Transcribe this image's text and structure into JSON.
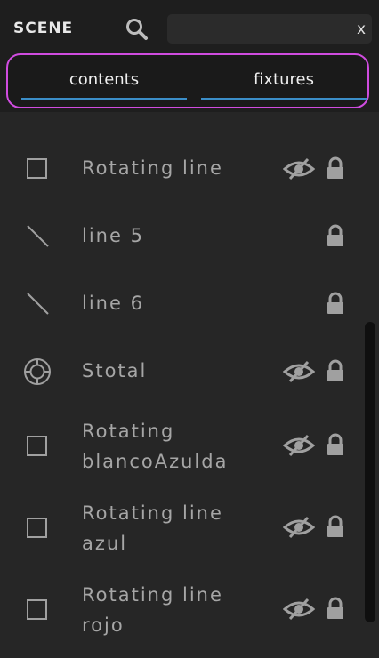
{
  "panel": {
    "title": "SCENE"
  },
  "search": {
    "value": "",
    "placeholder": "",
    "clear_label": "x"
  },
  "tabs": [
    {
      "label": "contents",
      "active": true
    },
    {
      "label": "fixtures",
      "active": false
    }
  ],
  "items": [
    {
      "label": "Rotating line",
      "kind": "square-icon",
      "hidden_toggle": true,
      "locked": true
    },
    {
      "label": "line 5",
      "kind": "line-icon",
      "hidden_toggle": false,
      "locked": true
    },
    {
      "label": "line 6",
      "kind": "line-icon",
      "hidden_toggle": false,
      "locked": true
    },
    {
      "label": "Stotal",
      "kind": "target-icon",
      "hidden_toggle": true,
      "locked": true
    },
    {
      "label_lines": [
        "Rotating",
        "blancoAzulda"
      ],
      "kind": "square-icon",
      "hidden_toggle": true,
      "locked": true
    },
    {
      "label_lines": [
        "Rotating line",
        "azul"
      ],
      "kind": "square-icon",
      "hidden_toggle": true,
      "locked": true
    },
    {
      "label_lines": [
        "Rotating line",
        "rojo"
      ],
      "kind": "square-icon",
      "hidden_toggle": true,
      "locked": true
    }
  ],
  "colors": {
    "accent": "#3b8ec8",
    "highlight": "#d04ce0",
    "background": "#262626"
  }
}
